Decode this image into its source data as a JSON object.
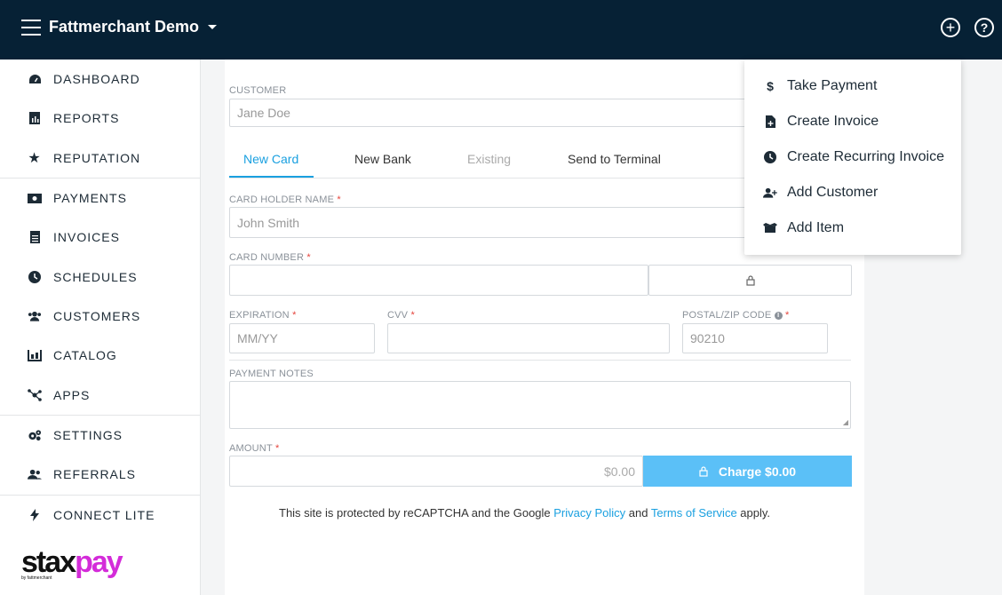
{
  "topbar": {
    "brand": "Fattmerchant Demo"
  },
  "sidebar": {
    "items": [
      {
        "label": "DASHBOARD",
        "icon": "dashboard-icon"
      },
      {
        "label": "REPORTS",
        "icon": "reports-icon"
      },
      {
        "label": "REPUTATION",
        "icon": "star-icon"
      },
      {
        "label": "PAYMENTS",
        "icon": "money-icon"
      },
      {
        "label": "INVOICES",
        "icon": "invoice-icon"
      },
      {
        "label": "SCHEDULES",
        "icon": "clock-icon"
      },
      {
        "label": "CUSTOMERS",
        "icon": "users-icon"
      },
      {
        "label": "CATALOG",
        "icon": "catalog-icon"
      },
      {
        "label": "APPS",
        "icon": "apps-icon"
      },
      {
        "label": "SETTINGS",
        "icon": "gears-icon"
      },
      {
        "label": "REFERRALS",
        "icon": "referrals-icon"
      },
      {
        "label": "CONNECT LITE",
        "icon": "bolt-icon"
      }
    ],
    "logo": {
      "stax": "stax",
      "pay": "pay",
      "sub": "by fattmerchant"
    }
  },
  "form": {
    "customer_label": "CUSTOMER",
    "customer_value": "Jane Doe",
    "tabs": [
      "New Card",
      "New Bank",
      "Existing",
      "Send to Terminal"
    ],
    "card_holder_label": "CARD HOLDER NAME",
    "card_holder_placeholder": "John Smith",
    "card_number_label": "CARD NUMBER",
    "expiration_label": "EXPIRATION",
    "expiration_placeholder": "MM/YY",
    "cvv_label": "CVV",
    "postal_label": "POSTAL/ZIP CODE",
    "postal_placeholder": "90210",
    "notes_label": "PAYMENT NOTES",
    "amount_label": "AMOUNT",
    "amount_placeholder": "$0.00",
    "required_mark": "*",
    "charge_label": "Charge $0.00",
    "recaptcha_pre": "This site is protected by reCAPTCHA and the Google ",
    "privacy_link": "Privacy Policy",
    "recaptcha_and": " and ",
    "terms_link": "Terms of Service",
    "recaptcha_post": " apply."
  },
  "dropdown": {
    "items": [
      {
        "label": "Take Payment",
        "icon": "dollar-icon"
      },
      {
        "label": "Create Invoice",
        "icon": "file-plus-icon"
      },
      {
        "label": "Create Recurring Invoice",
        "icon": "clock-icon"
      },
      {
        "label": "Add Customer",
        "icon": "user-plus-icon"
      },
      {
        "label": "Add Item",
        "icon": "box-icon"
      }
    ]
  },
  "colors": {
    "topbar": "#062135",
    "accent": "#1aa0e0",
    "charge_button": "#5bc0f7",
    "logo_pay": "#d42cd9"
  }
}
